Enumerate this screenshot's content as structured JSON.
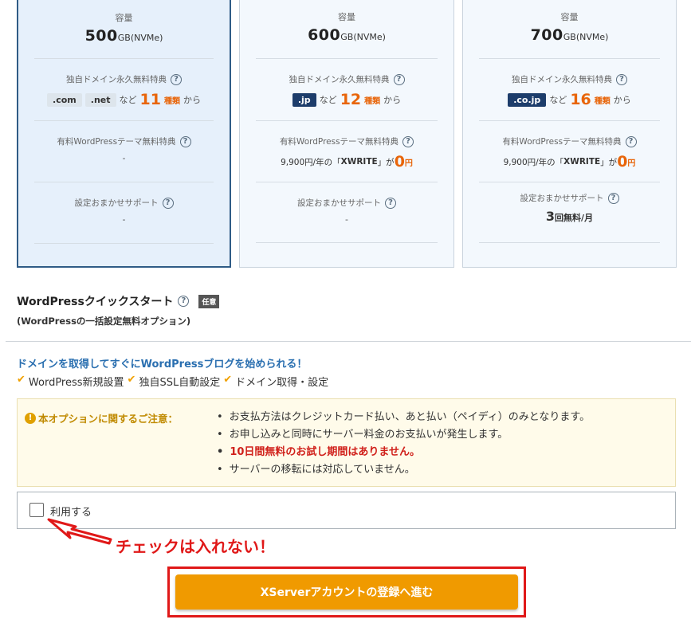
{
  "plans": [
    {
      "capacity_label": "容量",
      "capacity_number": "500",
      "capacity_unit": "GB(NVMe)",
      "domain_title": "独自ドメイン永久無料特典",
      "tlds": [
        ".com",
        ".net"
      ],
      "domain_prefix": "など",
      "domain_count": "11",
      "domain_suffix_kind": "種類",
      "domain_suffix": "から",
      "theme_title": "有料WordPressテーマ無料特典",
      "theme_value": "-",
      "support_title": "設定おまかせサポート",
      "support_value": "-"
    },
    {
      "capacity_label": "容量",
      "capacity_number": "600",
      "capacity_unit": "GB(NVMe)",
      "domain_title": "独自ドメイン永久無料特典",
      "tlds": [
        ".jp"
      ],
      "domain_prefix": "など",
      "domain_count": "12",
      "domain_suffix_kind": "種類",
      "domain_suffix": "から",
      "theme_title": "有料WordPressテーマ無料特典",
      "theme_price": "9,900円/年の「",
      "theme_name": "XWRITE",
      "theme_mid": "」が",
      "theme_free": "0",
      "theme_yen": "円",
      "support_title": "設定おまかせサポート",
      "support_value": "-"
    },
    {
      "capacity_label": "容量",
      "capacity_number": "700",
      "capacity_unit": "GB(NVMe)",
      "domain_title": "独自ドメイン永久無料特典",
      "tlds": [
        ".co.jp"
      ],
      "domain_prefix": "など",
      "domain_count": "16",
      "domain_suffix_kind": "種類",
      "domain_suffix": "から",
      "theme_title": "有料WordPressテーマ無料特典",
      "theme_price": "9,900円/年の「",
      "theme_name": "XWRITE",
      "theme_mid": "」が",
      "theme_free": "0",
      "theme_yen": "円",
      "support_title": "設定おまかせサポート",
      "support_count": "3",
      "support_unit": "回無料/月"
    }
  ],
  "help_icon_glyph": "?",
  "wpqs": {
    "title": "WordPressクイックスタート",
    "badge": "任意",
    "subtitle": "(WordPressの一括設定無料オプション)"
  },
  "promo": "ドメインを取得してすぐにWordPressブログを始められる！",
  "features": [
    "WordPress新規設置",
    "独自SSL自動設定",
    "ドメイン取得・設定"
  ],
  "notice": {
    "heading": "本オプションに関するご注意：",
    "items": [
      "お支払方法はクレジットカード払い、あと払い（ペイディ）のみとなります。",
      "お申し込みと同時にサーバー料金のお支払いが発生します。",
      "10日間無料のお試し期間はありません。",
      "サーバーの移転には対応していません。"
    ]
  },
  "use_option": {
    "label": "利用する",
    "checked": false
  },
  "annotation": "チェックは入れない！",
  "cta": {
    "label": "XServerアカウントの登録へ進む"
  },
  "colors": {
    "accent_orange": "#f09a00",
    "highlight_red": "#e01818",
    "link_blue": "#2a6fb0",
    "check_yellow": "#f0a000"
  }
}
